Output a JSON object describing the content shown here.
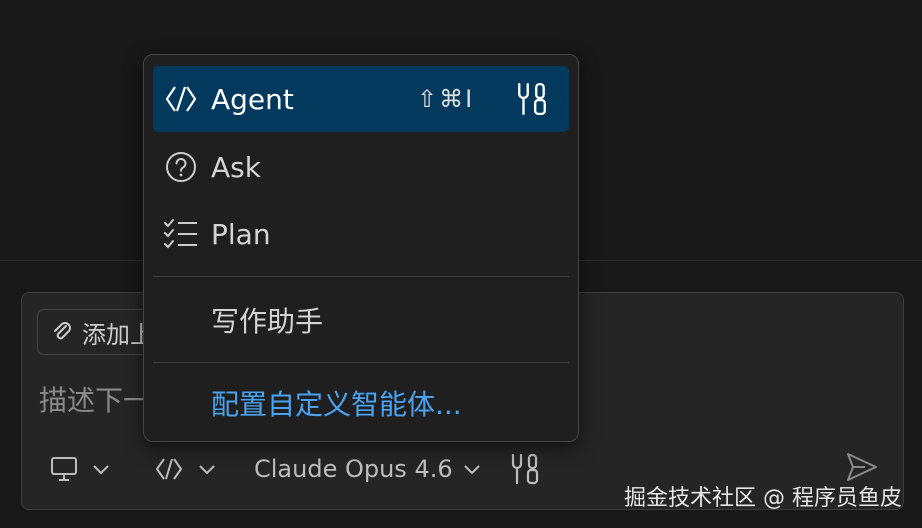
{
  "chat": {
    "add_context_label": "添加上下文",
    "input_placeholder": "描述下一步要构建的内容",
    "model_label": "Claude Opus 4.6"
  },
  "menu": {
    "items": [
      {
        "label": "Agent",
        "shortcut": "⇧⌘I",
        "icon": "agent-icon",
        "selected": true
      },
      {
        "label": "Ask",
        "icon": "question-circle-icon",
        "selected": false
      },
      {
        "label": "Plan",
        "icon": "checklist-icon",
        "selected": false
      },
      {
        "label": "写作助手",
        "selected": false
      },
      {
        "label": "配置自定义智能体...",
        "selected": false
      }
    ]
  },
  "watermark": "掘金技术社区 @ 程序员鱼皮",
  "colors": {
    "selected_bg": "#04395e",
    "link": "#4aa3f0",
    "background": "#181818"
  }
}
